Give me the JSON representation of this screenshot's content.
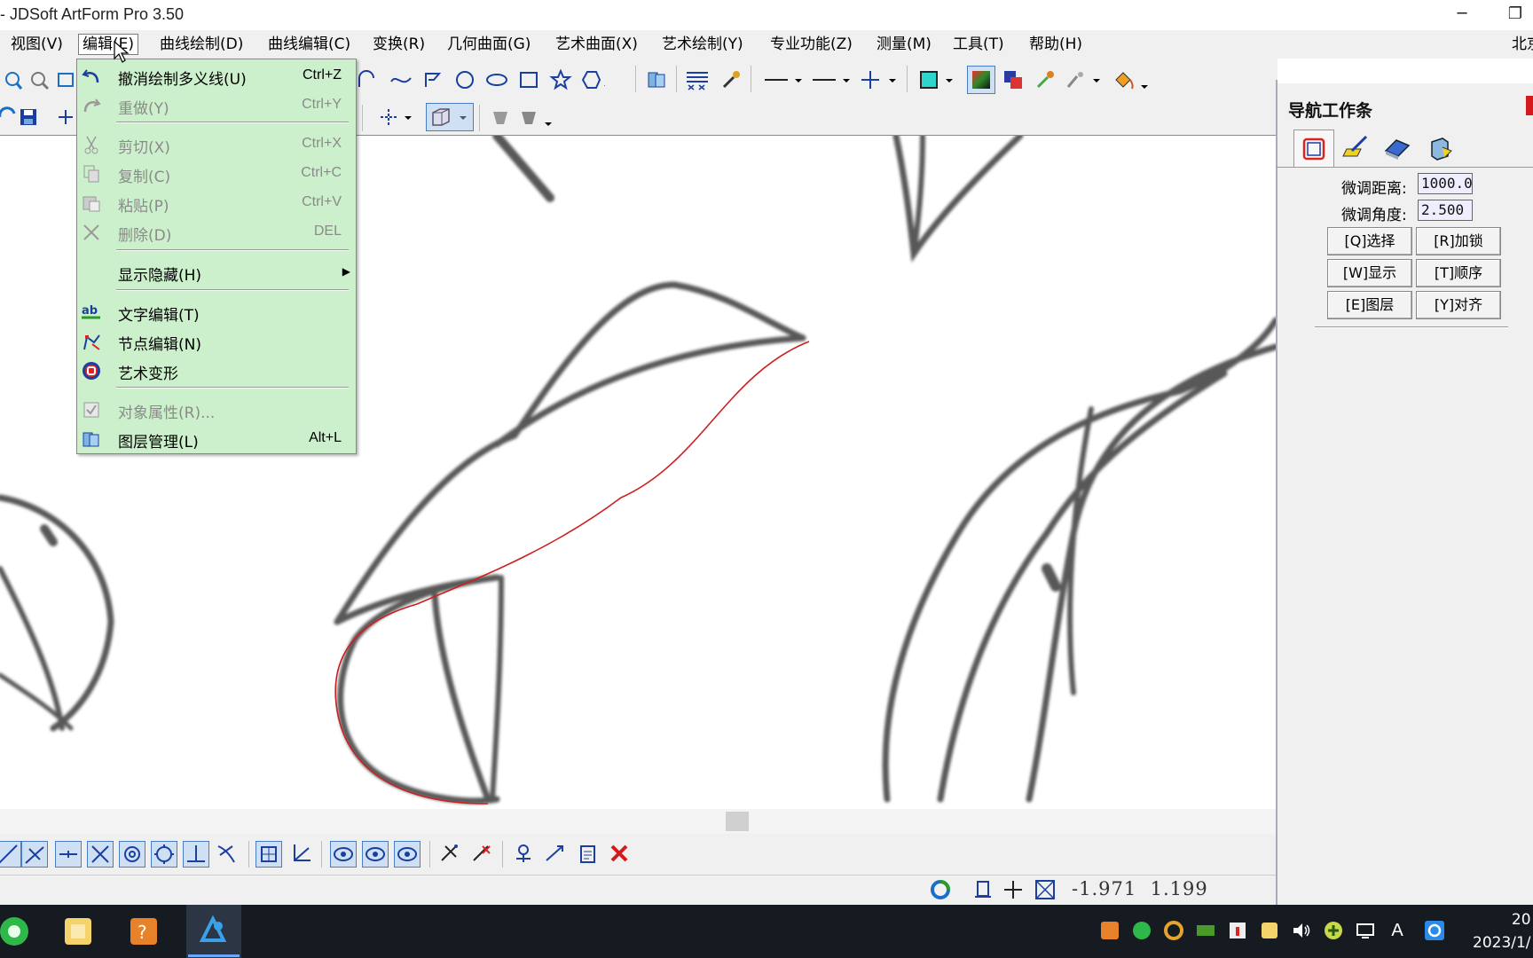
{
  "window": {
    "title": "- JDSoft ArtForm Pro 3.50",
    "minimize_glyph": "─",
    "restore_glyph": "❐"
  },
  "menubar": {
    "items": [
      "视图(V)",
      "编辑(E)",
      "曲线绘制(D)",
      "曲线编辑(C)",
      "变换(R)",
      "几何曲面(G)",
      "艺术曲面(X)",
      "艺术绘制(Y)",
      "专业功能(Z)",
      "测量(M)",
      "工具(T)",
      "帮助(H)"
    ],
    "active": "编辑(E)",
    "right_text": "北京"
  },
  "edit_menu": {
    "items": [
      {
        "label": "撤消绘制多义线(U)",
        "shortcut": "Ctrl+Z",
        "icon": "undo-icon",
        "enabled": true
      },
      {
        "label": "重做(Y)",
        "shortcut": "Ctrl+Y",
        "icon": "redo-icon",
        "enabled": false
      },
      {
        "label": "剪切(X)",
        "shortcut": "Ctrl+X",
        "icon": "cut-icon",
        "enabled": false
      },
      {
        "label": "复制(C)",
        "shortcut": "Ctrl+C",
        "icon": "copy-icon",
        "enabled": false
      },
      {
        "label": "粘贴(P)",
        "shortcut": "Ctrl+V",
        "icon": "paste-icon",
        "enabled": false
      },
      {
        "label": "删除(D)",
        "shortcut": "DEL",
        "icon": "delete-icon",
        "enabled": false
      },
      {
        "label": "显示隐藏(H)",
        "shortcut": "",
        "icon": "",
        "enabled": true,
        "submenu": true
      },
      {
        "label": "文字编辑(T)",
        "shortcut": "",
        "icon": "text-edit-icon",
        "enabled": true
      },
      {
        "label": "节点编辑(N)",
        "shortcut": "",
        "icon": "node-edit-icon",
        "enabled": true
      },
      {
        "label": "艺术变形",
        "shortcut": "",
        "icon": "art-deform-icon",
        "enabled": true
      },
      {
        "label": "对象属性(R)...",
        "shortcut": "",
        "icon": "properties-icon",
        "enabled": false
      },
      {
        "label": "图层管理(L)",
        "shortcut": "Alt+L",
        "icon": "layers-icon",
        "enabled": true
      }
    ],
    "submenu_arrow": "▶"
  },
  "nav_panel": {
    "title": "导航工作条",
    "tabs": [
      "view-cube-icon",
      "pen-surface-icon",
      "surface-icon",
      "solid-icon"
    ],
    "fine_distance_label": "微调距离:",
    "fine_distance_value": "1000.0",
    "fine_angle_label": "微调角度:",
    "fine_angle_value": "2.500",
    "buttons": [
      "[Q]选择",
      "[R]加锁",
      "[W]显示",
      "[T]顺序",
      "[E]图层",
      "[Y]对齐"
    ]
  },
  "status": {
    "coord_x": "-1.971",
    "coord_y": "1.199"
  },
  "clock": {
    "time": "20",
    "date": "2023/1/"
  },
  "colors": {
    "menu_bg": "#cdf0cc",
    "curve": "#cc1f1f",
    "taskbar": "#161b22"
  }
}
